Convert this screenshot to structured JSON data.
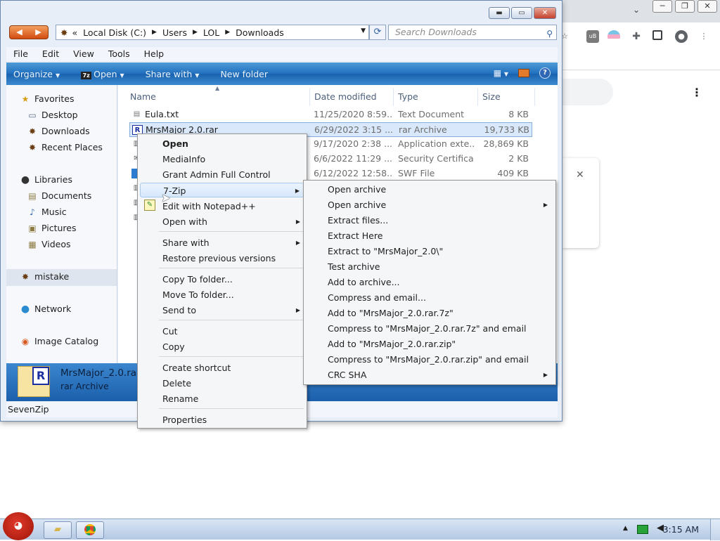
{
  "browser": {
    "window_buttons": [
      "─",
      "❐",
      "✕"
    ],
    "close_label": "✕",
    "menu_icon": "⋮"
  },
  "window": {
    "address": {
      "overflow": "«",
      "crumbs": [
        "Local Disk (C:)",
        "Users",
        "LOL",
        "Downloads"
      ],
      "sep": "▶",
      "dropdown": "▼"
    },
    "search_placeholder": "Search Downloads",
    "menubar": [
      "File",
      "Edit",
      "View",
      "Tools",
      "Help"
    ],
    "cmdbar": {
      "organize": "Organize",
      "open": "Open",
      "share_with": "Share with",
      "new_folder": "New folder"
    }
  },
  "nav": {
    "favorites": "Favorites",
    "desktop": "Desktop",
    "downloads": "Downloads",
    "recent": "Recent Places",
    "libraries": "Libraries",
    "documents": "Documents",
    "music": "Music",
    "pictures": "Pictures",
    "videos": "Videos",
    "mistake": "mistake",
    "network": "Network",
    "catalog": "Image Catalog"
  },
  "columns": {
    "name": "Name",
    "date": "Date modified",
    "type": "Type",
    "size": "Size"
  },
  "files": [
    {
      "name": "Eula.txt",
      "date": "11/25/2020 8:59...",
      "type": "Text Document",
      "size": "8 KB"
    },
    {
      "name": "MrsMajor 2.0.rar",
      "date": "6/29/2022 3:15 ...",
      "type": "rar Archive",
      "size": "19,733 KB"
    },
    {
      "name": "",
      "date": "9/17/2020 2:38 ...",
      "type": "Application exte...",
      "size": "28,869 KB"
    },
    {
      "name": "",
      "date": "6/6/2022 11:29 ...",
      "type": "Security Certifica...",
      "size": "2 KB"
    },
    {
      "name": "",
      "date": "6/12/2022 12:58...",
      "type": "SWF File",
      "size": "409 KB"
    }
  ],
  "details": {
    "name": "MrsMajor_2.0.rar",
    "type": "rar Archive"
  },
  "status": "SevenZip",
  "context_menu": {
    "open": "Open",
    "mediainfo": "MediaInfo",
    "grant": "Grant Admin Full Control",
    "sevenzip": "7-Zip",
    "notepad": "Edit with Notepad++",
    "open_with": "Open with",
    "share_with": "Share with",
    "restore": "Restore previous versions",
    "copy_to": "Copy To folder...",
    "move_to": "Move To folder...",
    "send_to": "Send to",
    "cut": "Cut",
    "copy": "Copy",
    "create_shortcut": "Create shortcut",
    "delete": "Delete",
    "rename": "Rename",
    "properties": "Properties"
  },
  "submenu": [
    "Open archive",
    "Open archive",
    "Extract files...",
    "Extract Here",
    "Extract to \"MrsMajor_2.0\\\"",
    "Test archive",
    "Add to archive...",
    "Compress and email...",
    "Add to \"MrsMajor_2.0.rar.7z\"",
    "Compress to \"MrsMajor_2.0.rar.7z\" and email",
    "Add to \"MrsMajor_2.0.rar.zip\"",
    "Compress to \"MrsMajor_2.0.rar.zip\" and email",
    "CRC SHA"
  ],
  "taskbar": {
    "clock": "3:15 AM"
  }
}
